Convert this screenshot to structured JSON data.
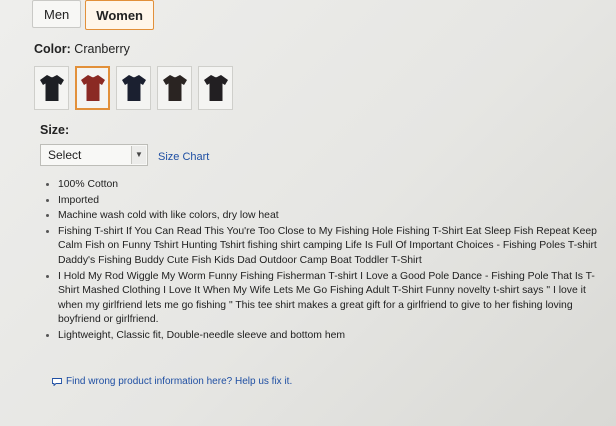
{
  "gender": {
    "tabs": [
      {
        "label": "Men",
        "selected": false
      },
      {
        "label": "Women",
        "selected": true
      }
    ]
  },
  "color": {
    "label": "Color:",
    "value": "Cranberry",
    "swatches": [
      {
        "color": "#1d1f24",
        "selected": false
      },
      {
        "color": "#8b2a24",
        "selected": true
      },
      {
        "color": "#1b2030",
        "selected": false
      },
      {
        "color": "#2a2422",
        "selected": false
      },
      {
        "color": "#221f22",
        "selected": false
      }
    ],
    "accent": "#e2903a"
  },
  "size": {
    "label": "Size:",
    "select_value": "Select",
    "chart_link": "Size Chart"
  },
  "features": [
    "100% Cotton",
    "Imported",
    "Machine wash cold with like colors, dry low heat",
    "Fishing T-shirt If You Can Read This You're Too Close to My Fishing Hole Fishing T-Shirt Eat Sleep Fish Repeat Keep Calm Fish on Funny Tshirt Hunting Tshirt fishing shirt camping Life Is Full Of Important Choices - Fishing Poles T-shirt Daddy's Fishing Buddy Cute Fish Kids Dad Outdoor Camp Boat Toddler T-Shirt",
    "I Hold My Rod Wiggle My Worm Funny Fishing Fisherman T-shirt I Love a Good Pole Dance - Fishing Pole That Is T-Shirt Mashed Clothing I Love It When My Wife Lets Me Go Fishing Adult T-Shirt Funny novelty t-shirt says \" I love it when my girlfriend lets me go fishing \" This tee shirt makes a great gift for a girlfriend to give to her fishing loving boyfriend or girlfriend.",
    "Lightweight, Classic fit, Double-needle sleeve and bottom hem"
  ],
  "feedback": {
    "link_text": "Find wrong product information here? Help us fix it."
  },
  "link_color": "#1f4fa3"
}
